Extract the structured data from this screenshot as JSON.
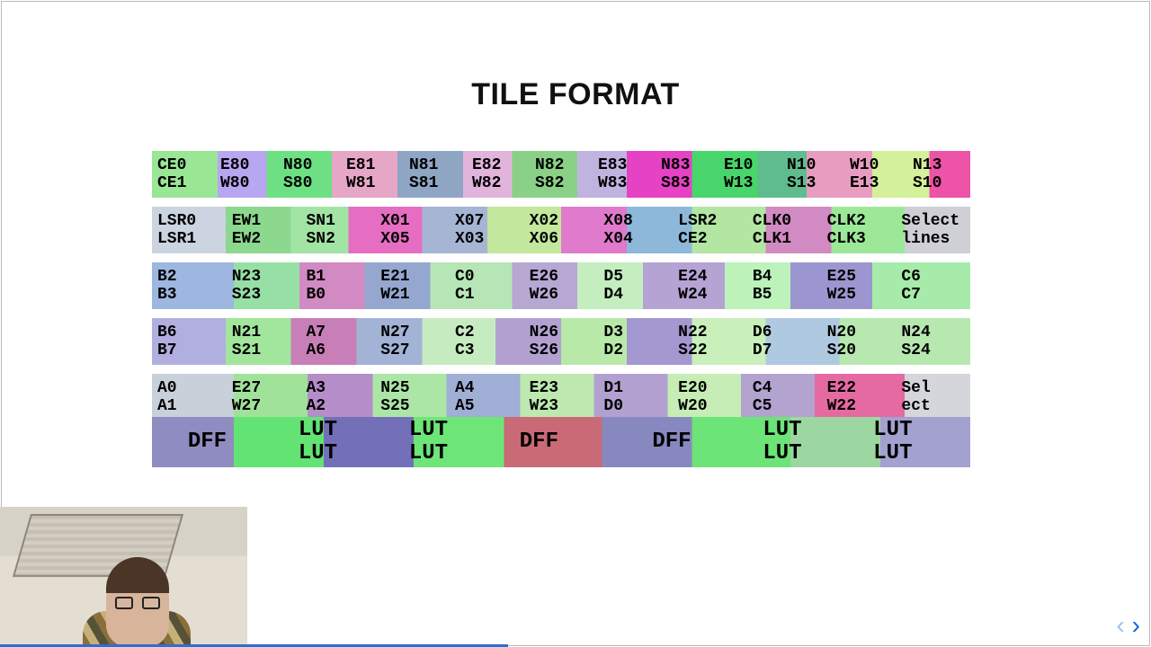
{
  "title": "TILE FORMAT",
  "rows": [
    [
      {
        "a": "CE0",
        "b": "CE1"
      },
      {
        "a": "E80",
        "b": "W80"
      },
      {
        "a": "N80",
        "b": "S80"
      },
      {
        "a": "E81",
        "b": "W81"
      },
      {
        "a": "N81",
        "b": "S81"
      },
      {
        "a": "E82",
        "b": "W82"
      },
      {
        "a": "N82",
        "b": "S82"
      },
      {
        "a": "E83",
        "b": "W83"
      },
      {
        "a": "N83",
        "b": "S83"
      },
      {
        "a": "E10",
        "b": "W13"
      },
      {
        "a": "N10",
        "b": "S13"
      },
      {
        "a": "W10",
        "b": "E13"
      },
      {
        "a": "N13",
        "b": "S10"
      }
    ],
    [
      {
        "a": "LSR0",
        "b": "LSR1"
      },
      {
        "a": "EW1",
        "b": "EW2"
      },
      {
        "a": "SN1",
        "b": "SN2"
      },
      {
        "a": "X01",
        "b": "X05"
      },
      {
        "a": "X07",
        "b": "X03"
      },
      {
        "a": "X02",
        "b": "X06"
      },
      {
        "a": "X08",
        "b": "X04"
      },
      {
        "a": "LSR2",
        "b": "CE2"
      },
      {
        "a": "CLK0",
        "b": "CLK1"
      },
      {
        "a": "CLK2",
        "b": "CLK3"
      },
      {
        "a": "Select",
        "b": "lines"
      }
    ],
    [
      {
        "a": "B2",
        "b": "B3"
      },
      {
        "a": "N23",
        "b": "S23"
      },
      {
        "a": "B1",
        "b": "B0"
      },
      {
        "a": "E21",
        "b": "W21"
      },
      {
        "a": "C0",
        "b": "C1"
      },
      {
        "a": "E26",
        "b": "W26"
      },
      {
        "a": "D5",
        "b": "D4"
      },
      {
        "a": "E24",
        "b": "W24"
      },
      {
        "a": "B4",
        "b": "B5"
      },
      {
        "a": "E25",
        "b": "W25"
      },
      {
        "a": "C6",
        "b": "C7"
      }
    ],
    [
      {
        "a": "B6",
        "b": "B7"
      },
      {
        "a": "N21",
        "b": "S21"
      },
      {
        "a": "A7",
        "b": "A6"
      },
      {
        "a": "N27",
        "b": "S27"
      },
      {
        "a": "C2",
        "b": "C3"
      },
      {
        "a": "N26",
        "b": "S26"
      },
      {
        "a": "D3",
        "b": "D2"
      },
      {
        "a": "N22",
        "b": "S22"
      },
      {
        "a": "D6",
        "b": "D7"
      },
      {
        "a": "N20",
        "b": "S20"
      },
      {
        "a": "N24",
        "b": "S24"
      }
    ],
    [
      {
        "a": "A0",
        "b": "A1"
      },
      {
        "a": "E27",
        "b": "W27"
      },
      {
        "a": "A3",
        "b": "A2"
      },
      {
        "a": "N25",
        "b": "S25"
      },
      {
        "a": "A4",
        "b": "A5"
      },
      {
        "a": "E23",
        "b": "W23"
      },
      {
        "a": "D1",
        "b": "D0"
      },
      {
        "a": "E20",
        "b": "W20"
      },
      {
        "a": "C4",
        "b": "C5"
      },
      {
        "a": "E22",
        "b": "W22"
      },
      {
        "a": "Sel",
        "b": "ect"
      }
    ]
  ],
  "bottom": [
    "DFF",
    "LUT LUT",
    "LUT LUT",
    "DFF",
    "",
    "DFF",
    "LUT LUT",
    "LUT LUT",
    ""
  ],
  "nav": {
    "prev": "‹",
    "next": "›"
  }
}
